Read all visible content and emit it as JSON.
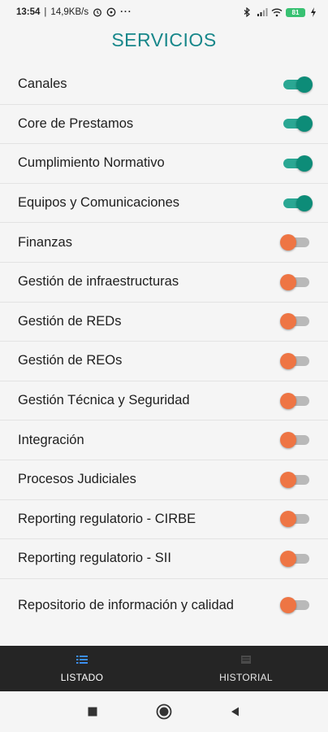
{
  "status_bar": {
    "time": "13:54",
    "network_speed": "14,9KB/s",
    "battery_level": "81",
    "more_indicator": "···"
  },
  "page": {
    "title": "SERVICIOS"
  },
  "services": [
    {
      "label": "Canales",
      "enabled": true
    },
    {
      "label": "Core de Prestamos",
      "enabled": true
    },
    {
      "label": "Cumplimiento Normativo",
      "enabled": true
    },
    {
      "label": "Equipos y Comunicaciones",
      "enabled": true
    },
    {
      "label": "Finanzas",
      "enabled": false
    },
    {
      "label": "Gestión de infraestructuras",
      "enabled": false
    },
    {
      "label": "Gestión de REDs",
      "enabled": false
    },
    {
      "label": "Gestión de REOs",
      "enabled": false
    },
    {
      "label": "Gestión Técnica y Seguridad",
      "enabled": false
    },
    {
      "label": "Integración",
      "enabled": false
    },
    {
      "label": "Procesos Judiciales",
      "enabled": false
    },
    {
      "label": "Reporting regulatorio - CIRBE",
      "enabled": false
    },
    {
      "label": "Reporting regulatorio - SII",
      "enabled": false
    },
    {
      "label": "Repositorio de información y calidad",
      "enabled": false
    }
  ],
  "bottom_nav": {
    "tabs": [
      {
        "label": "LISTADO",
        "icon": "list-icon",
        "active": true
      },
      {
        "label": "HISTORIAL",
        "icon": "history-icon",
        "active": false
      }
    ]
  },
  "colors": {
    "title": "#17878a",
    "toggle_on": "#0d8c78",
    "toggle_off": "#ee7544",
    "nav_bar": "#252525",
    "active_tab_icon": "#3b8ef0"
  }
}
